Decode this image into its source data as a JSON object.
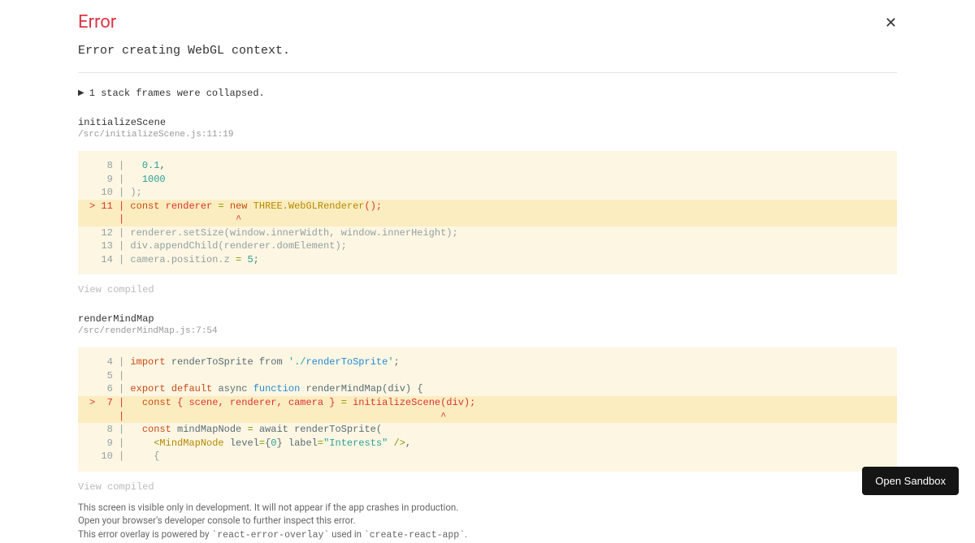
{
  "header": {
    "title": "Error",
    "message": "Error creating WebGL context."
  },
  "collapsed": {
    "text": "1 stack frames were collapsed."
  },
  "frames": [
    {
      "name": "initializeScene",
      "location": "/src/initializeScene.js:11:19",
      "view_compiled": "View compiled"
    },
    {
      "name": "renderMindMap",
      "location": "/src/renderMindMap.js:7:54",
      "view_compiled": "View compiled"
    }
  ],
  "code1": {
    "l8": "   8 | ",
    "l8n": "0.1",
    "l8e": ",",
    "l9": "   9 | ",
    "l9n": "1000",
    "l10": "  10 | );",
    "l11p": "> 11 | ",
    "l11a": "const",
    "l11b": " renderer ",
    "l11c": "=",
    "l11d": " ",
    "l11e": "new",
    "l11f": " ",
    "l11g": "THREE.WebGLRenderer",
    "l11h": "();",
    "lcaret": "     |                   ^",
    "l12": "  12 | renderer.setSize(window.innerWidth, window.innerHeight);",
    "l13": "  13 | div.appendChild(renderer.domElement);",
    "l14a": "  14 | camera.position.z ",
    "l14b": "=",
    "l14c": " ",
    "l14d": "5",
    "l14e": ";"
  },
  "code2": {
    "l4a": "   4 | ",
    "l4b": "import",
    "l4c": " renderToSprite from ",
    "l4d": "'./",
    "l4e": "renderToSprite",
    "l4f": "'",
    "l4g": ";",
    "l5": "   5 | ",
    "l6a": "   6 | ",
    "l6b": "export",
    "l6c": " ",
    "l6d": "default",
    "l6e": " async ",
    "l6f": "function",
    "l6g": " renderMindMap(div) {",
    "l7p": ">  7 | ",
    "l7a": "const",
    "l7b": " { scene, renderer, camera } ",
    "l7c": "=",
    "l7d": " initializeScene(div);",
    "lcaret": "     |                                                      ^",
    "l8a": "   8 |   ",
    "l8b": "const",
    "l8c": " mindMapNode ",
    "l8d": "=",
    "l8e": " await renderToSprite(",
    "l9a": "   9 |     ",
    "l9b": "<",
    "l9c": "MindMapNode",
    "l9d": " level",
    "l9e": "=",
    "l9f": "{",
    "l9g": "0",
    "l9h": "}",
    "l9i": " label",
    "l9j": "=",
    "l9k": "\"Interests\"",
    "l9l": " />",
    "l9m": ",",
    "l10": "  10 |     {"
  },
  "footer": {
    "line1": "This screen is visible only in development. It will not appear if the app crashes in production.",
    "line2": "Open your browser's developer console to further inspect this error.",
    "line3a": "This error overlay is powered by ",
    "line3b": "`react-error-overlay`",
    "line3c": " used in ",
    "line3d": "`create-react-app`",
    "line3e": "."
  },
  "sandbox_button": "Open Sandbox"
}
